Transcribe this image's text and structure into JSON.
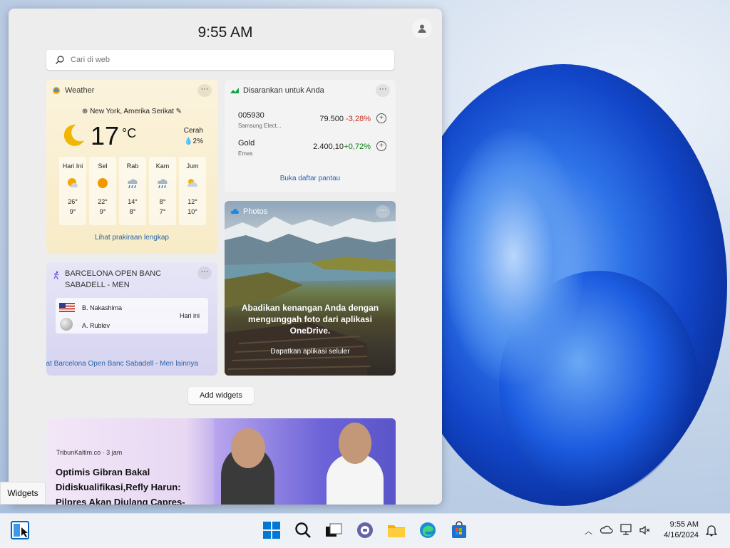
{
  "panel": {
    "time": "9:55 AM",
    "search_placeholder": "Cari di web",
    "add_widgets": "Add widgets"
  },
  "weather": {
    "title": "Weather",
    "location": "New York, Amerika Serikat",
    "temperature": "17",
    "unit": "°C",
    "condition": "Cerah",
    "precip": "2%",
    "days": [
      {
        "name": "Hari Ini",
        "high": "26°",
        "low": "9°",
        "icon": "partly-sunny-icon"
      },
      {
        "name": "Sel",
        "high": "22°",
        "low": "9°",
        "icon": "sunny-icon"
      },
      {
        "name": "Rab",
        "high": "14°",
        "low": "8°",
        "icon": "rain-icon"
      },
      {
        "name": "Kam",
        "high": "8°",
        "low": "7°",
        "icon": "rain-icon"
      },
      {
        "name": "Jum",
        "high": "12°",
        "low": "10°",
        "icon": "cloudy-icon"
      }
    ],
    "forecast_link": "Lihat prakiraan lengkap"
  },
  "stocks": {
    "title": "Disarankan untuk Anda",
    "rows": [
      {
        "symbol": "005930",
        "name": "Samsung Elect...",
        "price": "79.500",
        "change": "-3,28%",
        "color": "#c42b1c"
      },
      {
        "symbol": "Gold",
        "name": "Emas",
        "price": "2.400,10",
        "change": "+0,72%",
        "color": "#0f7b0f"
      }
    ],
    "watchlist_link": "Buka daftar pantau"
  },
  "photos": {
    "title": "Photos",
    "message": "Abadikan kenangan Anda dengan mengunggah foto dari aplikasi OneDrive.",
    "link": "Dapatkan aplikasi seluler"
  },
  "sports": {
    "title": "BARCELONA OPEN BANC SABADELL - MEN",
    "player1": "B. Nakashima",
    "player2": "A. Rublev",
    "when": "Hari ini",
    "link": "hat Barcelona Open Banc Sabadell - Men lainnya"
  },
  "news": {
    "source": "TribunKaltim.co · 3 jam",
    "headline": "Optimis Gibran Bakal Didiskualifikasi,Refly Harun: Pilpres Akan Diulang Capres-"
  },
  "tooltip": "Widgets",
  "taskbar": {
    "time": "9:55 AM",
    "date": "4/16/2024"
  },
  "colors": {
    "accent": "#0067c0",
    "link": "#2c64a6"
  }
}
